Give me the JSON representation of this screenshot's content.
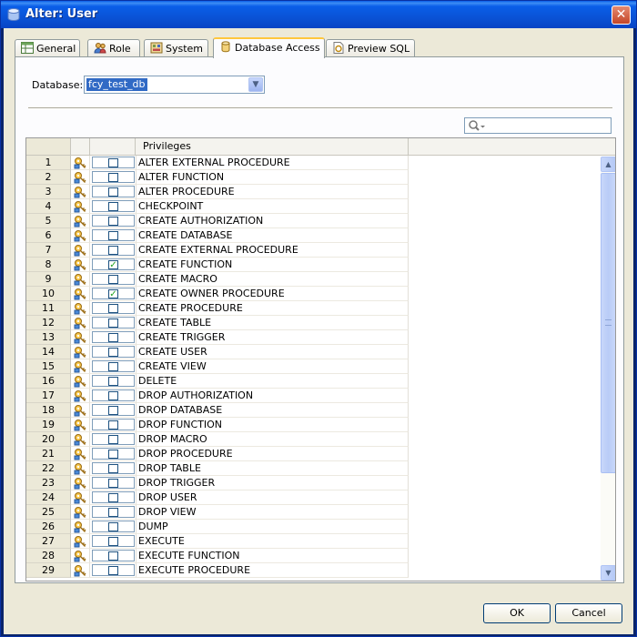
{
  "window": {
    "title": "Alter: User",
    "close_glyph": "✕"
  },
  "tabs": [
    {
      "label": "General",
      "icon": "table-icon",
      "active": false
    },
    {
      "label": "Role",
      "icon": "users-icon",
      "active": false
    },
    {
      "label": "System",
      "icon": "system-icon",
      "active": false
    },
    {
      "label": "Database Access",
      "icon": "database-key-icon",
      "active": true
    },
    {
      "label": "Preview SQL",
      "icon": "sql-document-icon",
      "active": false
    }
  ],
  "database": {
    "label": "Database:",
    "value": "fcy_test_db"
  },
  "filter": {
    "value": ""
  },
  "grid": {
    "header": {
      "privileges": "Privileges"
    },
    "rows": [
      {
        "num": "1",
        "name": "ALTER EXTERNAL PROCEDURE",
        "checked": false
      },
      {
        "num": "2",
        "name": "ALTER FUNCTION",
        "checked": false
      },
      {
        "num": "3",
        "name": "ALTER PROCEDURE",
        "checked": false
      },
      {
        "num": "4",
        "name": "CHECKPOINT",
        "checked": false
      },
      {
        "num": "5",
        "name": "CREATE AUTHORIZATION",
        "checked": false
      },
      {
        "num": "6",
        "name": "CREATE DATABASE",
        "checked": false
      },
      {
        "num": "7",
        "name": "CREATE EXTERNAL PROCEDURE",
        "checked": false
      },
      {
        "num": "8",
        "name": "CREATE FUNCTION",
        "checked": true
      },
      {
        "num": "9",
        "name": "CREATE MACRO",
        "checked": false
      },
      {
        "num": "10",
        "name": "CREATE OWNER PROCEDURE",
        "checked": true
      },
      {
        "num": "11",
        "name": "CREATE PROCEDURE",
        "checked": false
      },
      {
        "num": "12",
        "name": "CREATE TABLE",
        "checked": false
      },
      {
        "num": "13",
        "name": "CREATE TRIGGER",
        "checked": false
      },
      {
        "num": "14",
        "name": "CREATE USER",
        "checked": false
      },
      {
        "num": "15",
        "name": "CREATE VIEW",
        "checked": false
      },
      {
        "num": "16",
        "name": "DELETE",
        "checked": false
      },
      {
        "num": "17",
        "name": "DROP AUTHORIZATION",
        "checked": false
      },
      {
        "num": "18",
        "name": "DROP DATABASE",
        "checked": false
      },
      {
        "num": "19",
        "name": "DROP FUNCTION",
        "checked": false
      },
      {
        "num": "20",
        "name": "DROP MACRO",
        "checked": false
      },
      {
        "num": "21",
        "name": "DROP PROCEDURE",
        "checked": false
      },
      {
        "num": "22",
        "name": "DROP TABLE",
        "checked": false
      },
      {
        "num": "23",
        "name": "DROP TRIGGER",
        "checked": false
      },
      {
        "num": "24",
        "name": "DROP USER",
        "checked": false
      },
      {
        "num": "25",
        "name": "DROP VIEW",
        "checked": false
      },
      {
        "num": "26",
        "name": "DUMP",
        "checked": false
      },
      {
        "num": "27",
        "name": "EXECUTE",
        "checked": false
      },
      {
        "num": "28",
        "name": "EXECUTE FUNCTION",
        "checked": false
      },
      {
        "num": "29",
        "name": "EXECUTE PROCEDURE",
        "checked": false
      }
    ],
    "check_glyph": "✓"
  },
  "buttons": {
    "ok": "OK",
    "cancel": "Cancel"
  }
}
